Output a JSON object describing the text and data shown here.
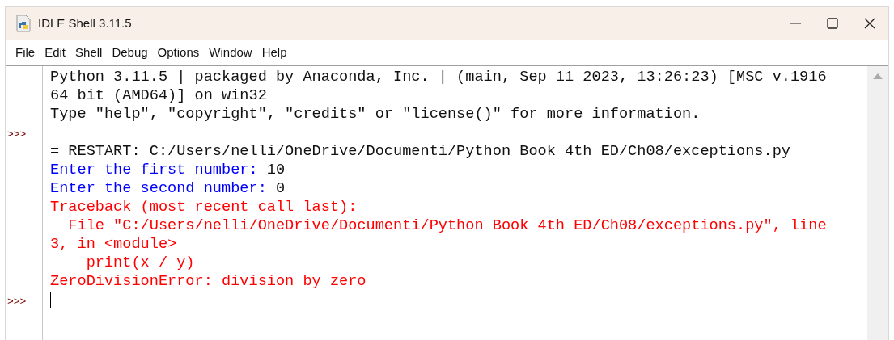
{
  "window": {
    "title": "IDLE Shell 3.11.5"
  },
  "menu": [
    "File",
    "Edit",
    "Shell",
    "Debug",
    "Options",
    "Window",
    "Help"
  ],
  "lines": [
    {
      "spans": [
        {
          "kind": "output",
          "text": "Python 3.11.5 | packaged by Anaconda, Inc. | (main, Sep 11 2023, 13:26:23) [MSC v.1916"
        }
      ]
    },
    {
      "spans": [
        {
          "kind": "output",
          "text": "64 bit (AMD64)] on win32"
        }
      ]
    },
    {
      "spans": [
        {
          "kind": "output",
          "text": "Type \"help\", \"copyright\", \"credits\" or \"license()\" for more information."
        }
      ]
    },
    {
      "prompt": ">>>"
    },
    {
      "spans": [
        {
          "kind": "output",
          "text": "= RESTART: C:/Users/nelli/OneDrive/Documenti/Python Book 4th ED/Ch08/exceptions.py"
        }
      ]
    },
    {
      "spans": [
        {
          "kind": "stdout",
          "text": "Enter the first number: "
        },
        {
          "kind": "input",
          "text": "10"
        }
      ]
    },
    {
      "spans": [
        {
          "kind": "stdout",
          "text": "Enter the second number: "
        },
        {
          "kind": "input",
          "text": "0"
        }
      ]
    },
    {
      "spans": [
        {
          "kind": "error",
          "text": "Traceback (most recent call last):"
        }
      ]
    },
    {
      "spans": [
        {
          "kind": "error",
          "text": "  File \"C:/Users/nelli/OneDrive/Documenti/Python Book 4th ED/Ch08/exceptions.py\", line"
        }
      ]
    },
    {
      "spans": [
        {
          "kind": "error",
          "text": "3, in <module>"
        }
      ]
    },
    {
      "spans": [
        {
          "kind": "error",
          "text": "    print(x / y)"
        }
      ]
    },
    {
      "spans": [
        {
          "kind": "error",
          "text": "ZeroDivisionError: division by zero"
        }
      ]
    },
    {
      "prompt": ">>>",
      "cursor": true
    }
  ]
}
